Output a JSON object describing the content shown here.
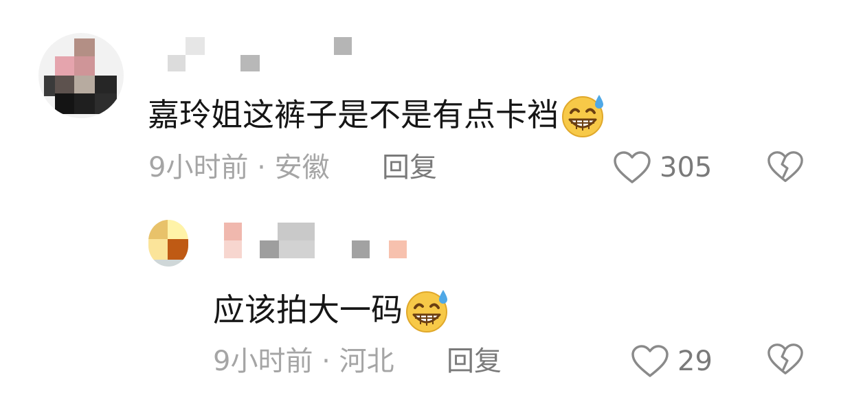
{
  "comments": [
    {
      "text": "嘉玲姐这裤子是不是有点卡裆",
      "emoji": "grinning-sweat-emoji",
      "time": "9小时前",
      "separator": " · ",
      "location": "安徽",
      "reply_label": "回复",
      "likes": "305"
    },
    {
      "text": "应该拍大一码",
      "emoji": "grinning-sweat-emoji",
      "time": "9小时前",
      "separator": " · ",
      "location": "河北",
      "reply_label": "回复",
      "likes": "29"
    }
  ],
  "colors": {
    "text": "#161616",
    "meta": "#a5a5a5",
    "action": "#7a7a7a",
    "emoji_face": "#f7c948",
    "emoji_sweat": "#4fa8e6"
  }
}
